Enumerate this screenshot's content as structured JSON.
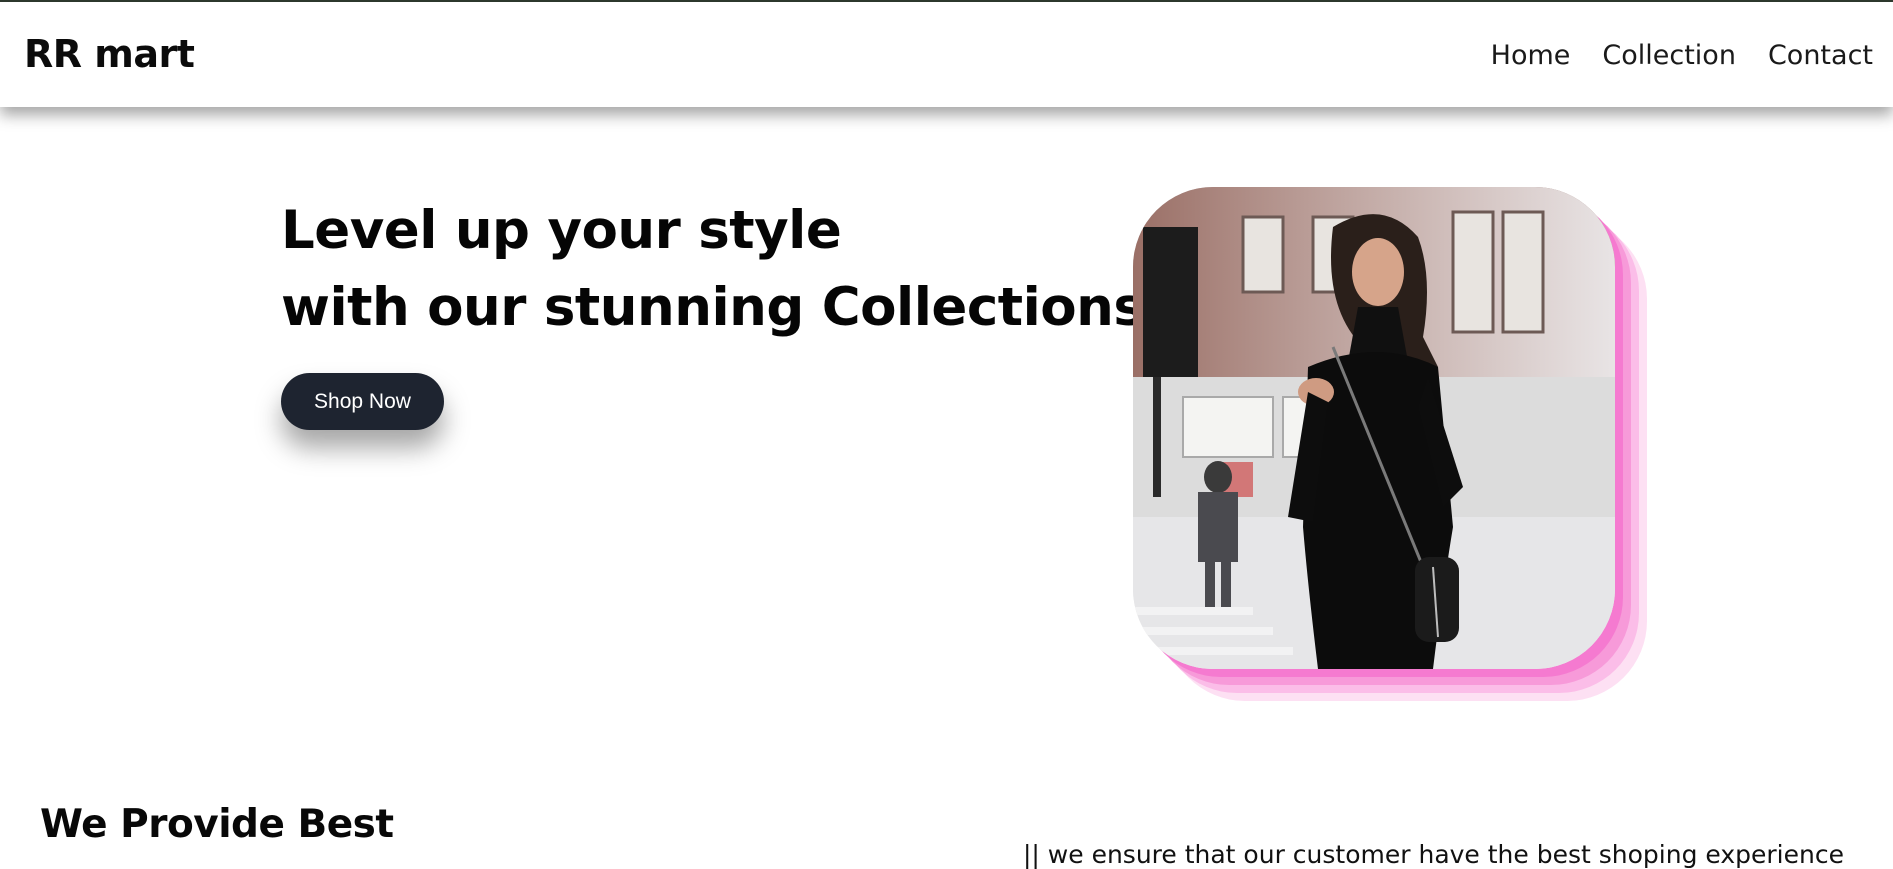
{
  "navbar": {
    "logo": "RR mart",
    "links": [
      "Home",
      "Collection",
      "Contact"
    ]
  },
  "hero": {
    "title_line1": "Level up your style",
    "title_line2": "with our stunning Collections",
    "cta_label": "Shop Now",
    "image_alt": "Model in black dress walking on city street"
  },
  "section": {
    "title": "We Provide Best",
    "text": "|| we ensure that our customer have the best shoping experience"
  },
  "colors": {
    "accent_pink": "#f57ad0",
    "button_dark": "#1e2430"
  }
}
